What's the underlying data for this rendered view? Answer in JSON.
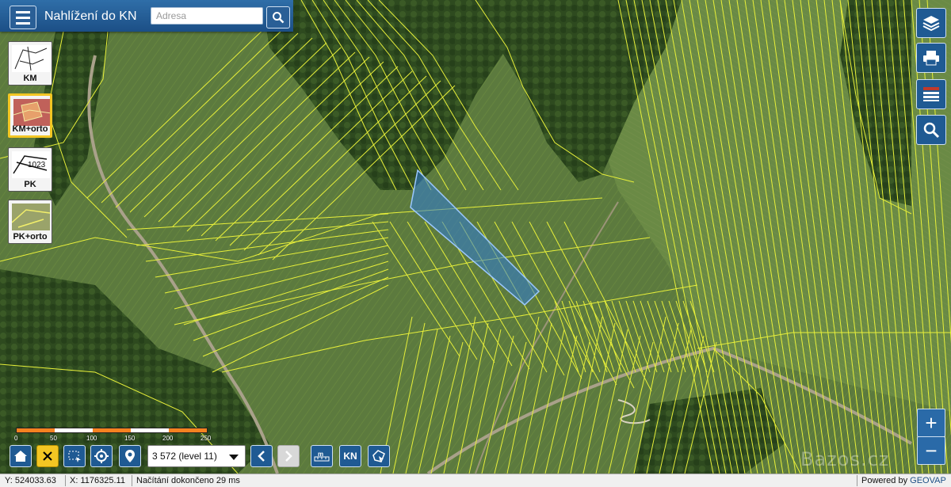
{
  "header": {
    "title": "Nahlížení do KN",
    "address_placeholder": "Adresa"
  },
  "layers": [
    {
      "label": "KM",
      "active": false
    },
    {
      "label": "KM+orto",
      "active": true
    },
    {
      "label": "PK",
      "active": false
    },
    {
      "label": "PK+orto",
      "active": false
    }
  ],
  "right_tools": [
    "layers-icon",
    "print-icon",
    "legend-icon",
    "search-icon"
  ],
  "zoom": {
    "in": "+",
    "out": "−"
  },
  "scale_bar": {
    "ticks": [
      "0",
      "50",
      "100",
      "150",
      "200",
      "250"
    ]
  },
  "toolbar": {
    "scale_select": "3 572 (level 11)",
    "kn_label": "KN"
  },
  "status": {
    "y": "Y: 524033.63",
    "x": "X: 1176325.11",
    "loading": "Načítání dokončeno 29 ms",
    "powered_prefix": "Powered by",
    "powered_brand": "GEOVAP"
  },
  "watermark": "Bazos.cz",
  "colors": {
    "parcel_lines": "#e8f03a",
    "selected_parcel": "#2f7bd6",
    "toolbar_blue": "#1f5a93",
    "active_yellow": "#f3c623"
  }
}
